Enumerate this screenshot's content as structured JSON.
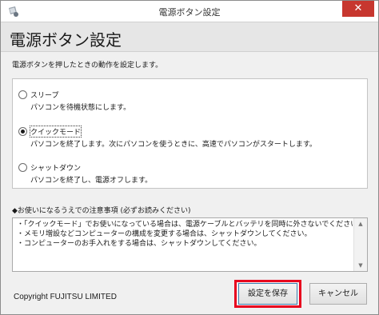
{
  "window": {
    "title": "電源ボタン設定",
    "close_glyph": "✕"
  },
  "header": {
    "title": "電源ボタン設定"
  },
  "instruction": "電源ボタンを押したときの動作を設定します。",
  "options": [
    {
      "label": "スリープ",
      "description": "パソコンを待機状態にします。",
      "selected": false
    },
    {
      "label": "クイックモード",
      "description": "パソコンを終了します。次にパソコンを使うときに、高速でパソコンがスタートします。",
      "selected": true
    },
    {
      "label": "シャットダウン",
      "description": "パソコンを終了し、電源オフします。",
      "selected": false
    }
  ],
  "notice": {
    "title": "◆お使いになるうえでの注意事項 (必ずお読みください)",
    "lines": [
      "・「クイックモード」でお使いになっている場合は、電源ケーブルとバッテリを同時に外さないでください。",
      "・メモリ増設などコンピューターの構成を変更する場合は、シャットダウンしてください。",
      "・コンピューターのお手入れをする場合は、シャットダウンしてください。"
    ]
  },
  "footer": {
    "copyright": "Copyright FUJITSU LIMITED",
    "save_label": "設定を保存",
    "cancel_label": "キャンセル"
  },
  "colors": {
    "highlight": "#e8001e",
    "close_button": "#c7372f",
    "header_bg": "#e6e6e6"
  },
  "icons": {
    "app": "power-settings-icon",
    "close": "close-icon",
    "scroll_up": "scroll-up-arrow-icon",
    "scroll_down": "scroll-down-arrow-icon"
  }
}
